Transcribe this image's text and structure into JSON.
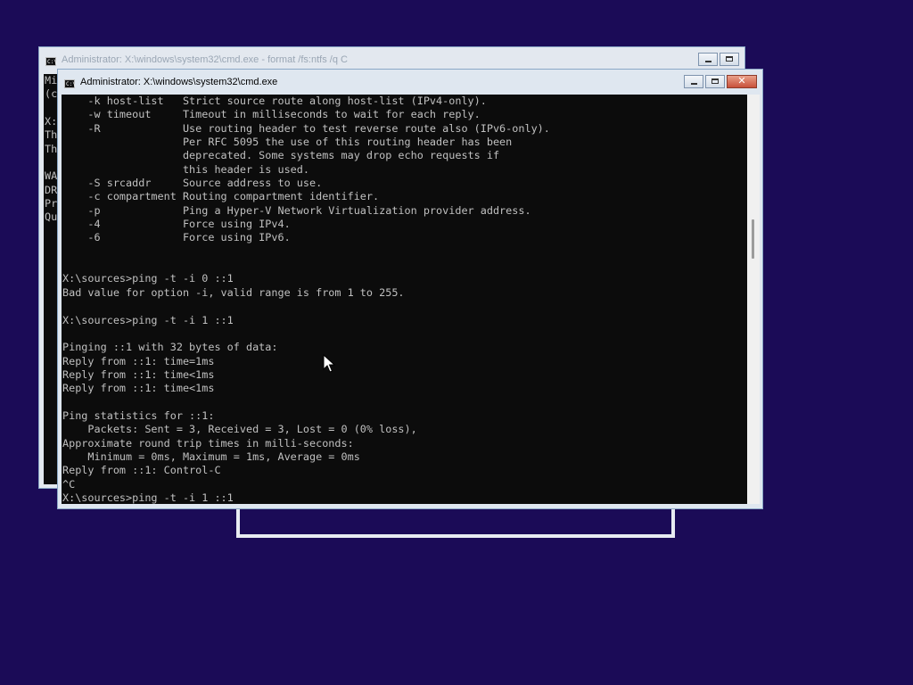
{
  "back_window": {
    "title": "Administrator: X:\\windows\\system32\\cmd.exe - format  /fs:ntfs /q C",
    "lines": [
      "Mi",
      "(c",
      "",
      "X:",
      "Th",
      "Th",
      "",
      "WA",
      "DR",
      "Pr",
      "Qu"
    ]
  },
  "front_window": {
    "title": "Administrator: X:\\windows\\system32\\cmd.exe",
    "lines": [
      "    -k host-list   Strict source route along host-list (IPv4-only).",
      "    -w timeout     Timeout in milliseconds to wait for each reply.",
      "    -R             Use routing header to test reverse route also (IPv6-only).",
      "                   Per RFC 5095 the use of this routing header has been",
      "                   deprecated. Some systems may drop echo requests if",
      "                   this header is used.",
      "    -S srcaddr     Source address to use.",
      "    -c compartment Routing compartment identifier.",
      "    -p             Ping a Hyper-V Network Virtualization provider address.",
      "    -4             Force using IPv4.",
      "    -6             Force using IPv6.",
      "",
      "",
      "X:\\sources>ping -t -i 0 ::1",
      "Bad value for option -i, valid range is from 1 to 255.",
      "",
      "X:\\sources>ping -t -i 1 ::1",
      "",
      "Pinging ::1 with 32 bytes of data:",
      "Reply from ::1: time=1ms",
      "Reply from ::1: time<1ms",
      "Reply from ::1: time<1ms",
      "",
      "Ping statistics for ::1:",
      "    Packets: Sent = 3, Received = 3, Lost = 0 (0% loss),",
      "Approximate round trip times in milli-seconds:",
      "    Minimum = 0ms, Maximum = 1ms, Average = 0ms",
      "Reply from ::1: Control-C",
      "^C",
      "X:\\sources>ping -t -i 1 ::1"
    ]
  },
  "icons": {
    "cmd": "command-prompt-icon",
    "minimize": "minimize-icon",
    "maximize": "maximize-icon",
    "close": "close-icon",
    "pointer": "mouse-pointer-icon"
  },
  "colors": {
    "desktop": "#1b0b57",
    "console_bg": "#0c0c0c",
    "console_text": "#c0c0c0",
    "close_button": "#c8513a"
  }
}
